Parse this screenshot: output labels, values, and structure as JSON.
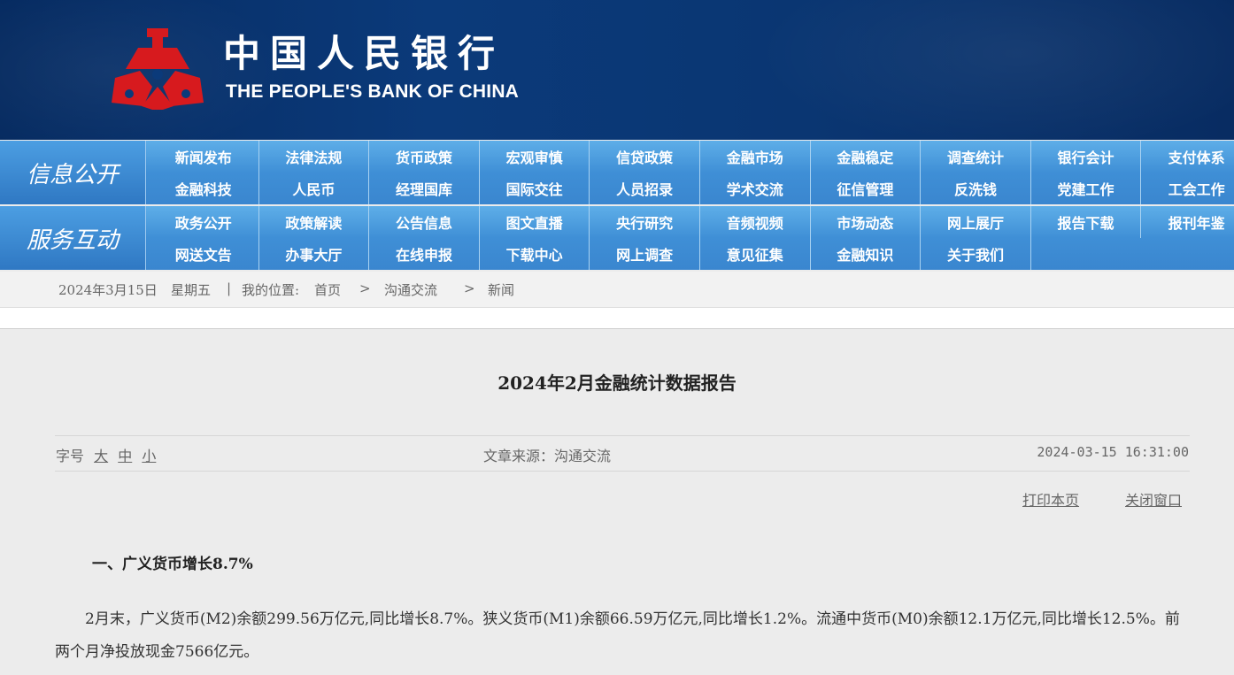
{
  "header": {
    "logo_cn": "中国人民银行",
    "logo_en": "THE PEOPLE'S BANK OF CHINA",
    "logo_color": "#d71a1e",
    "banner_color": "#0b3a7a"
  },
  "nav": [
    {
      "title": "信息公开",
      "rows": [
        [
          "新闻发布",
          "法律法规",
          "货币政策",
          "宏观审慎",
          "信贷政策",
          "金融市场",
          "金融稳定",
          "调查统计",
          "银行会计",
          "支付体系"
        ],
        [
          "金融科技",
          "人民币",
          "经理国库",
          "国际交往",
          "人员招录",
          "学术交流",
          "征信管理",
          "反洗钱",
          "党建工作",
          "工会工作"
        ]
      ]
    },
    {
      "title": "服务互动",
      "rows": [
        [
          "政务公开",
          "政策解读",
          "公告信息",
          "图文直播",
          "央行研究",
          "音频视频",
          "市场动态",
          "网上展厅",
          "报告下载",
          "报刊年鉴"
        ],
        [
          "网送文告",
          "办事大厅",
          "在线申报",
          "下载中心",
          "网上调查",
          "意见征集",
          "金融知识",
          "关于我们"
        ]
      ]
    }
  ],
  "breadcrumb": {
    "date": "2024年3月15日",
    "weekday": "星期五",
    "separator": "|",
    "location_label": "我的位置:",
    "home": "首页",
    "arrow": ">",
    "level1": "沟通交流",
    "level2": "新闻"
  },
  "article": {
    "title": "2024年2月金融统计数据报告",
    "font_size_label": "字号",
    "font_sizes": [
      "大",
      "中",
      "小"
    ],
    "source": "文章来源：沟通交流",
    "datetime": "2024-03-15 16:31:00",
    "print_label": "打印本页",
    "close_label": "关闭窗口",
    "section_heading": "一、广义货币增长8.7%",
    "paragraph": "2月末，广义货币(M2)余额299.56万亿元,同比增长8.7%。狭义货币(M1)余额66.59万亿元,同比增长1.2%。流通中货币(M0)余额12.1万亿元,同比增长12.5%。前两个月净投放现金7566亿元。"
  }
}
